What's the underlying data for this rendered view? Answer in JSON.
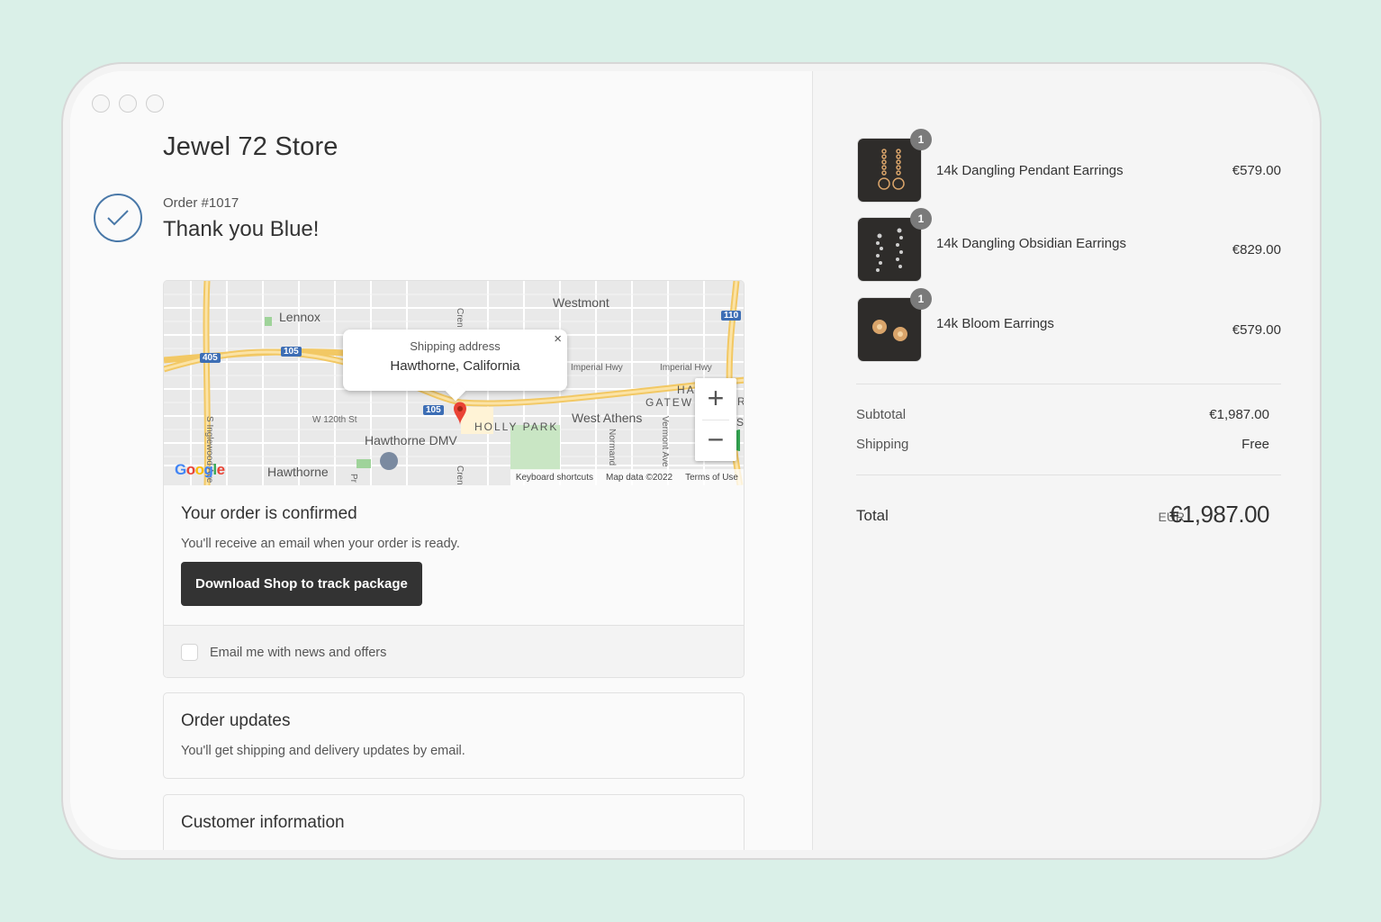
{
  "store": {
    "title": "Jewel 72 Store"
  },
  "order": {
    "number": "Order #1017",
    "thanks": "Thank you Blue!"
  },
  "map": {
    "labels": {
      "lennox": "Lennox",
      "westmont": "Westmont",
      "hawthorne": "Hawthorne",
      "hawthorne_dmv": "Hawthorne DMV",
      "west_athens": "West Athens",
      "holly_park": "HOLLY PARK",
      "gateway": "GATEW",
      "ha": "HA",
      "w120": "W 120th St",
      "imperial1": "Imperial Hwy",
      "imperial2": "Imperial Hwy",
      "inglewood": "S Inglewood Ave",
      "normand": "Normand",
      "vermont": "Vermont Ave",
      "cren1": "Cren",
      "cren2": "Cren",
      "pr": "Pr",
      "r": "R",
      "s": "S",
      "i405": "405",
      "i105a": "105",
      "i105b": "105",
      "i110": "110"
    },
    "popup": {
      "label": "Shipping address",
      "value": "Hawthorne, California",
      "close": "×"
    },
    "zoom": {
      "in": "+",
      "out": "−"
    },
    "footer": {
      "shortcuts": "Keyboard shortcuts",
      "mapdata": "Map data ©2022",
      "terms": "Terms of Use"
    },
    "google": "Google"
  },
  "confirmation": {
    "title": "Your order is confirmed",
    "text": "You'll receive an email when your order is ready.",
    "button": "Download Shop to track package",
    "email_opt": "Email me with news and offers"
  },
  "updates": {
    "title": "Order updates",
    "text": "You'll get shipping and delivery updates by email."
  },
  "customer": {
    "title": "Customer information"
  },
  "cart": {
    "items": [
      {
        "qty": "1",
        "name": "14k Dangling Pendant Earrings",
        "price": "€579.00"
      },
      {
        "qty": "1",
        "name": "14k Dangling Obsidian Earrings",
        "price": "€829.00"
      },
      {
        "qty": "1",
        "name": "14k Bloom Earrings",
        "price": "€579.00"
      }
    ],
    "subtotal_label": "Subtotal",
    "subtotal_value": "€1,987.00",
    "shipping_label": "Shipping",
    "shipping_value": "Free",
    "total_label": "Total",
    "total_currency": "EUR",
    "total_value": "€1,987.00"
  }
}
